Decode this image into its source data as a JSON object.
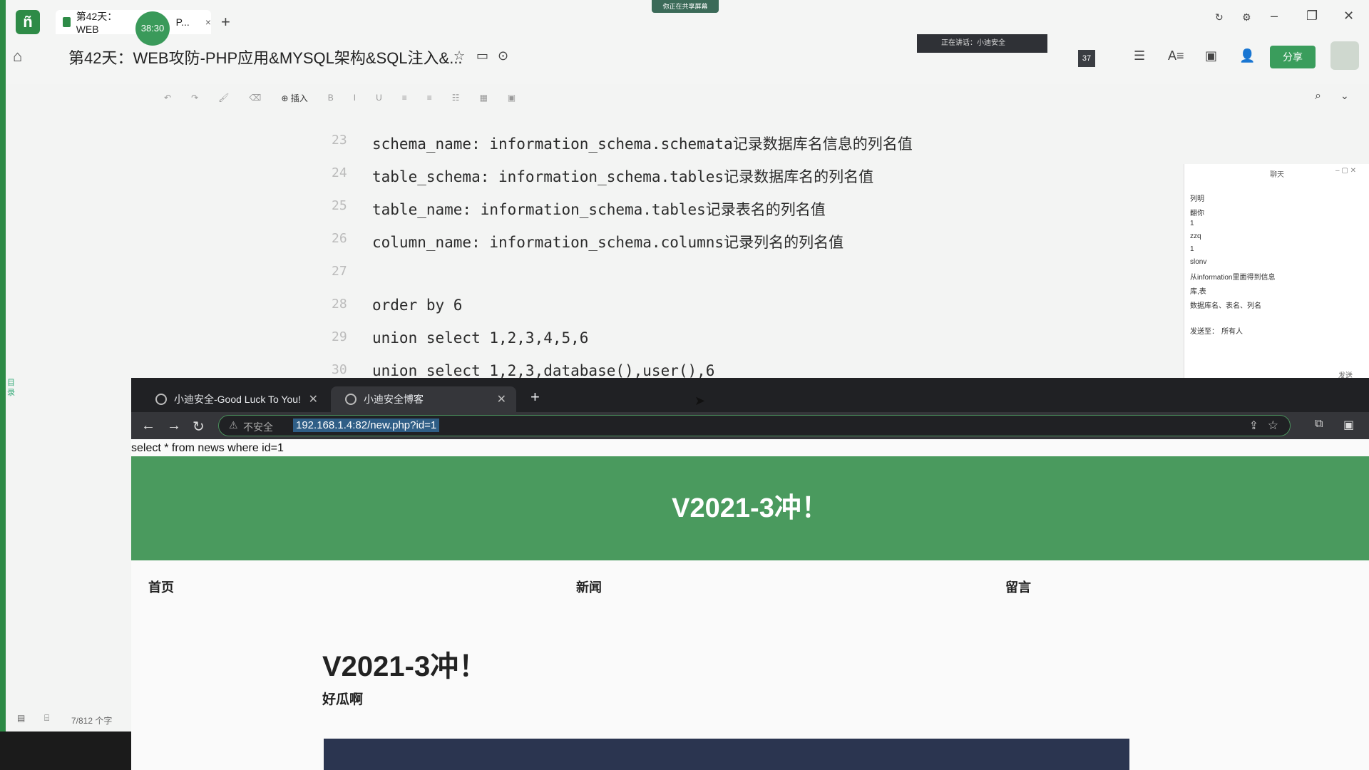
{
  "app": {
    "tab_title": "第42天：WEB",
    "tab_suffix": "P...",
    "timer": "38:30",
    "doc_title": "第42天：WEB攻防-PHP应用&MYSQL架构&SQL注入&...",
    "share_label": "分享",
    "speaking_label": "正在讲话：小迪安全",
    "sharing_banner": "你正在共享屏幕",
    "badge_count": "37",
    "toolbar_insert": "插入"
  },
  "editor": {
    "lines": [
      {
        "num": "23",
        "text": "schema_name: information_schema.schemata记录数据库名信息的列名值"
      },
      {
        "num": "24",
        "text": "table_schema: information_schema.tables记录数据库名的列名值"
      },
      {
        "num": "25",
        "text": "table_name: information_schema.tables记录表名的列名值"
      },
      {
        "num": "26",
        "text": "column_name: information_schema.columns记录列名的列名值"
      },
      {
        "num": "27",
        "text": ""
      },
      {
        "num": "28",
        "text": "order by 6"
      },
      {
        "num": "29",
        "text": "union select 1,2,3,4,5,6"
      },
      {
        "num": "30",
        "text": "union select 1,2,3,database(),user(),6"
      }
    ]
  },
  "chat": {
    "title": "聊天",
    "lines": [
      "列明",
      "翻你",
      "1",
      "zzq",
      "1",
      "slonv",
      "从information里面得到信息",
      "库,表",
      "数据库名、表名、列名"
    ],
    "send_to_label": "发送至：",
    "send_to_value": "所有人",
    "send_button": "发送"
  },
  "left": {
    "directory_label": "目录",
    "word_count": "7/812 个字"
  },
  "browser": {
    "tab1": "小迪安全-Good Luck To You!",
    "tab2": "小迪安全博客",
    "insecure_label": "不安全",
    "url": "192.168.1.4:82/new.php?id=1",
    "sql_text": "select * from news where id=1",
    "hero_title": "V2021-3冲！",
    "nav": [
      "首页",
      "新闻",
      "留言"
    ],
    "article_title": "V2021-3冲！",
    "article_subtitle": "好瓜啊"
  }
}
